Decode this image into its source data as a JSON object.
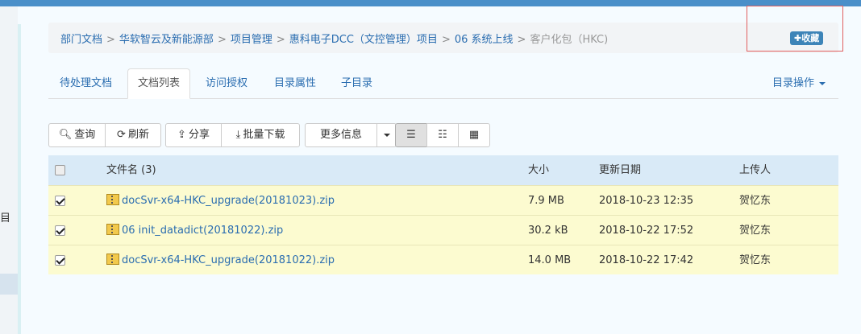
{
  "breadcrumb": {
    "items": [
      "部门文档",
      "华软智云及新能源部",
      "项目管理",
      "惠科电子DCC（文控管理）项目",
      "06 系统上线"
    ],
    "current": "客户化包（HKC)",
    "separator": ">"
  },
  "favorite_label": "收藏",
  "left_nav": {
    "label": "目"
  },
  "tabs": [
    "待处理文档",
    "文档列表",
    "访问授权",
    "目录属性",
    "子目录"
  ],
  "active_tab": "文档列表",
  "dir_ops_label": "目录操作",
  "toolbar": {
    "query": "查询",
    "refresh": "刷新",
    "share": "分享",
    "batch_download": "批量下载",
    "more_info": "更多信息"
  },
  "table": {
    "headers": {
      "name": "文件名 (3)",
      "size": "大小",
      "date": "更新日期",
      "uploader": "上传人"
    },
    "rows": [
      {
        "name": "docSvr-x64-HKC_upgrade(20181023).zip",
        "size": "7.9 MB",
        "date": "2018-10-23 12:35",
        "uploader": "贺忆东",
        "checked": true
      },
      {
        "name": "06 init_datadict(20181022).zip",
        "size": "30.2 kB",
        "date": "2018-10-22 17:52",
        "uploader": "贺忆东",
        "checked": true
      },
      {
        "name": "docSvr-x64-HKC_upgrade(20181022).zip",
        "size": "14.0 MB",
        "date": "2018-10-22 17:42",
        "uploader": "贺忆东",
        "checked": true
      }
    ]
  },
  "colors": {
    "accent": "#2a6db0",
    "header_bar": "#4a8fc9",
    "row_highlight": "#fcfbd0",
    "table_head": "#d9eaf7"
  }
}
